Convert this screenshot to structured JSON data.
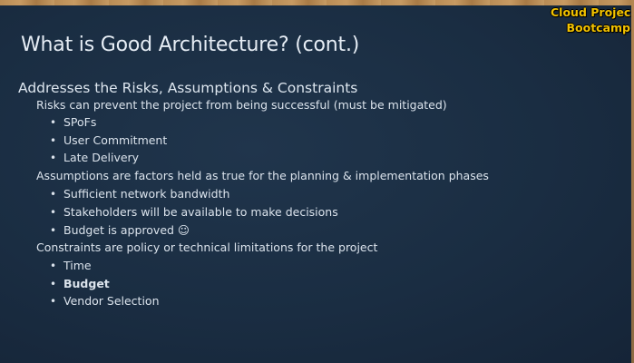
{
  "brand": {
    "line1": "Cloud Projec",
    "line2": "Bootcamp"
  },
  "slide": {
    "title": "What is Good Architecture? (cont.)",
    "heading": "Addresses the Risks, Assumptions & Constraints",
    "sections": [
      {
        "text": "Risks can prevent the project from being successful (must be mitigated)",
        "bullets": [
          "SPoFs",
          "User Commitment",
          "Late Delivery"
        ]
      },
      {
        "text": "Assumptions are factors held as true for the planning & implementation phases",
        "bullets": [
          "Sufficient network bandwidth",
          "Stakeholders will be available to make decisions",
          "Budget is approved ☺"
        ]
      },
      {
        "text": "Constraints are policy or technical limitations for the project",
        "bullets": [
          "Time",
          "Budget",
          "Vendor Selection"
        ]
      }
    ],
    "bullet_char": "•"
  },
  "colors": {
    "background": "#1c2a3a",
    "brand_text": "#f2c200",
    "text": "#dbe3ec"
  }
}
